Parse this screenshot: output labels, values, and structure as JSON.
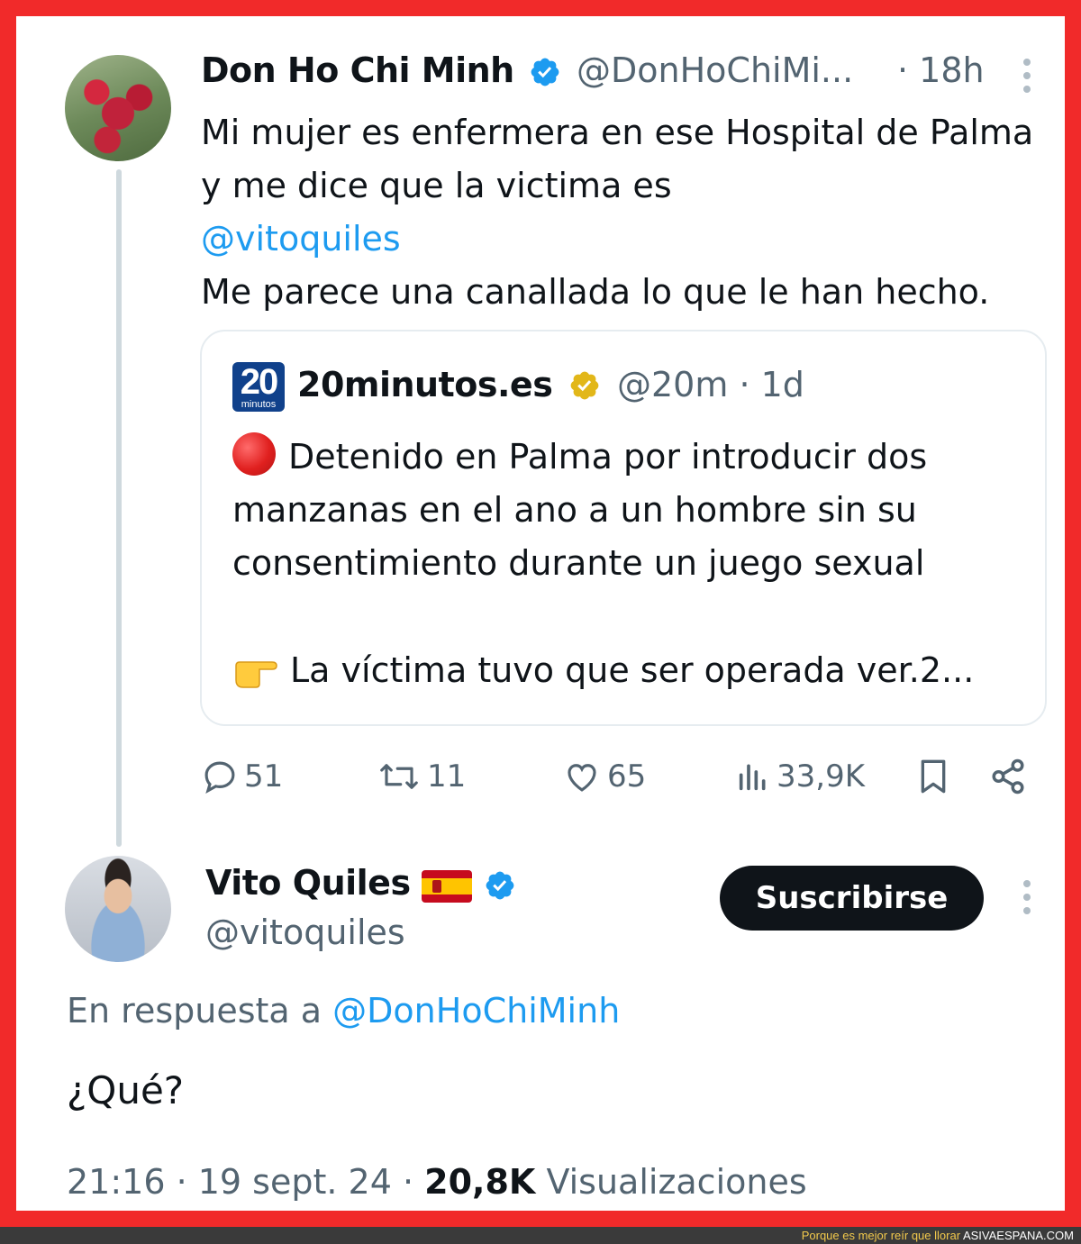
{
  "tweet": {
    "author_name": "Don Ho Chi Minh",
    "author_handle": "@DonHoChiMi...",
    "time": "· 18h",
    "text_line1": "Mi mujer es enfermera en ese Hospital de Palma y me dice que la victima es",
    "mention": "@vitoquiles",
    "text_line2": "Me parece una canallada lo que le han hecho.",
    "quoted": {
      "logo_number": "20",
      "logo_text": "minutos",
      "author_name": "20minutos.es",
      "author_handle": "@20m · 1d",
      "text": "Detenido en Palma por introducir dos manzanas en el ano a un hombre sin su consentimiento durante un juego sexual",
      "text2": "La víctima tuvo que ser operada ver.2..."
    },
    "actions": {
      "replies": "51",
      "retweets": "11",
      "likes": "65",
      "views": "33,9K"
    }
  },
  "reply": {
    "author_name": "Vito Quiles",
    "author_handle": "@vitoquiles",
    "subscribe_label": "Suscribirse",
    "reply_to_prefix": "En respuesta a",
    "reply_to_handle": "@DonHoChiMinh",
    "text": "¿Qué?",
    "timestamp": "21:16 · 19 sept. 24 ·",
    "views_count": "20,8K",
    "views_label": "Visualizaciones"
  },
  "footer": {
    "slogan": "Porque es mejor reír que llorar",
    "site": "ASIVAESPANA.COM"
  },
  "colors": {
    "border": "#f12a2a",
    "link": "#1d9bf0",
    "verified_blue": "#1d9bf0",
    "verified_gold": "#e2b719",
    "muted": "#536471"
  }
}
